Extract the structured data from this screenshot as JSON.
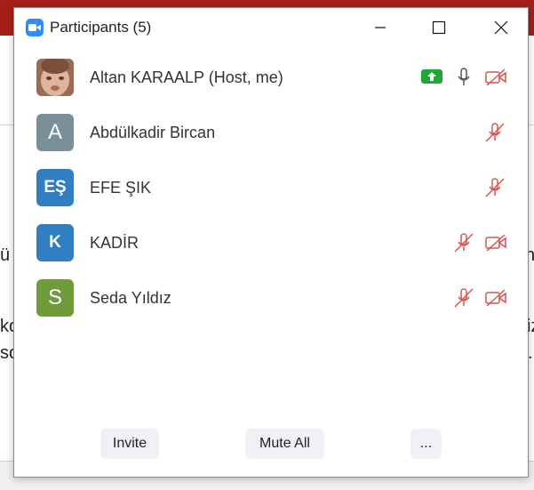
{
  "window": {
    "title": "Participants (5)",
    "controls": [
      "minimize",
      "maximize",
      "close"
    ]
  },
  "participants": [
    {
      "name": "Altan KARAALP (Host, me)",
      "avatar_type": "photo",
      "initials": "",
      "avatar_color": "#b98a72",
      "sharing": true,
      "mic": "on",
      "video": "off"
    },
    {
      "name": "Abdülkadir Bircan",
      "avatar_type": "initials",
      "initials": "A",
      "avatar_color": "#7a8f98",
      "sharing": false,
      "mic": "muted",
      "video": "none"
    },
    {
      "name": "EFE ŞIK",
      "avatar_type": "initials",
      "initials": "EŞ",
      "avatar_color": "#2f7fc1",
      "sharing": false,
      "mic": "muted",
      "video": "none"
    },
    {
      "name": "KADİR",
      "avatar_type": "initials",
      "initials": "K",
      "avatar_color": "#2f7fc1",
      "sharing": false,
      "mic": "muted",
      "video": "off"
    },
    {
      "name": "Seda Yıldız",
      "avatar_type": "initials",
      "initials": "S",
      "avatar_color": "#6f9c3b",
      "sharing": false,
      "mic": "muted",
      "video": "off"
    }
  ],
  "footer": {
    "invite_label": "Invite",
    "mute_all_label": "Mute All",
    "more_label": "..."
  },
  "colors": {
    "muted_red": "#d9534f",
    "share_green": "#1fa637",
    "app_blue": "#2d8cff"
  },
  "background_fragments": [
    "ü",
    "n",
    "ko",
    "iz",
    "so",
    "."
  ]
}
